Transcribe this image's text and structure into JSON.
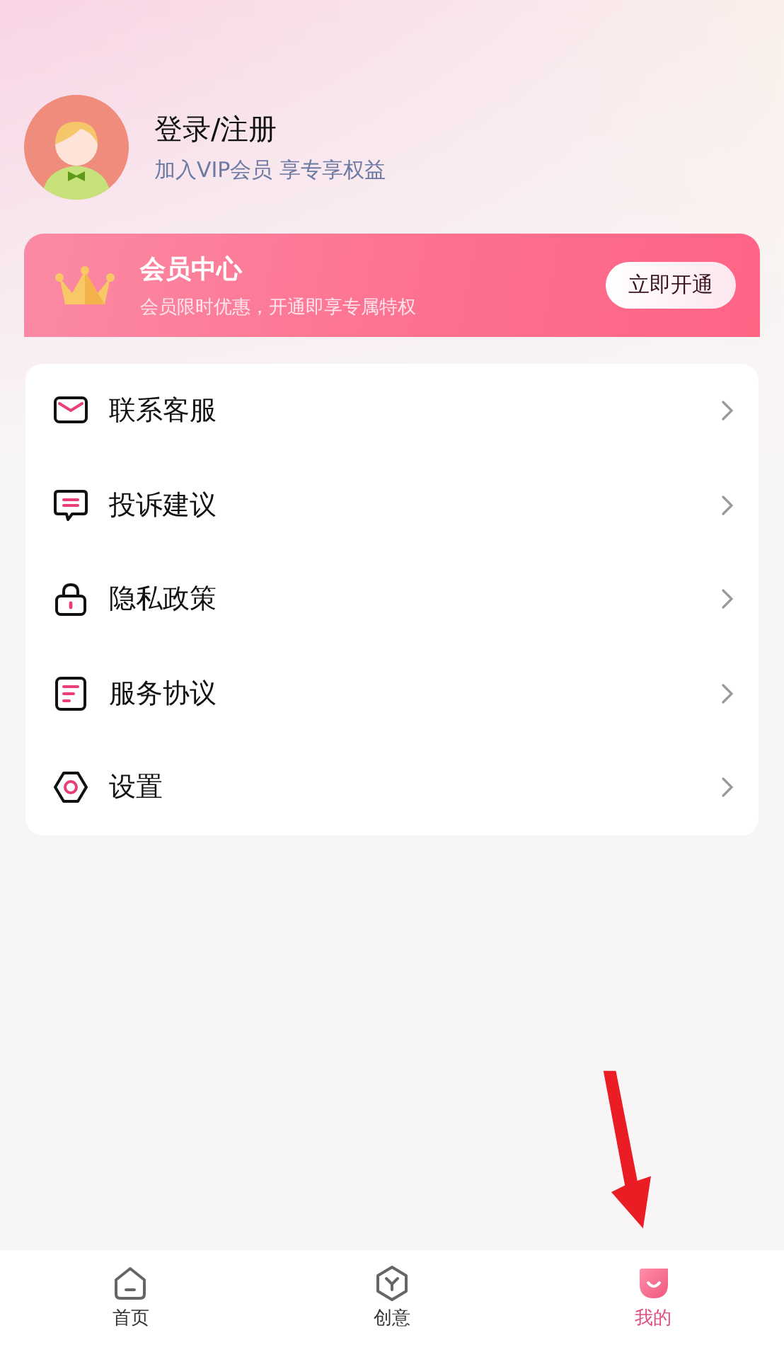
{
  "profile": {
    "title": "登录/注册",
    "subtitle": "加入VIP会员 享专享权益"
  },
  "vip_banner": {
    "title": "会员中心",
    "subtitle": "会员限时优惠，开通即享专属特权",
    "button": "立即开通"
  },
  "menu": [
    {
      "kind": "mail",
      "label": "联系客服"
    },
    {
      "kind": "chat",
      "label": "投诉建议"
    },
    {
      "kind": "lock",
      "label": "隐私政策"
    },
    {
      "kind": "doc",
      "label": "服务协议"
    },
    {
      "kind": "settings",
      "label": "设置"
    }
  ],
  "tab_bar": [
    {
      "kind": "home",
      "label": "首页",
      "selected": false
    },
    {
      "kind": "create",
      "label": "创意",
      "selected": false
    },
    {
      "kind": "mine",
      "label": "我的",
      "selected": true
    }
  ]
}
